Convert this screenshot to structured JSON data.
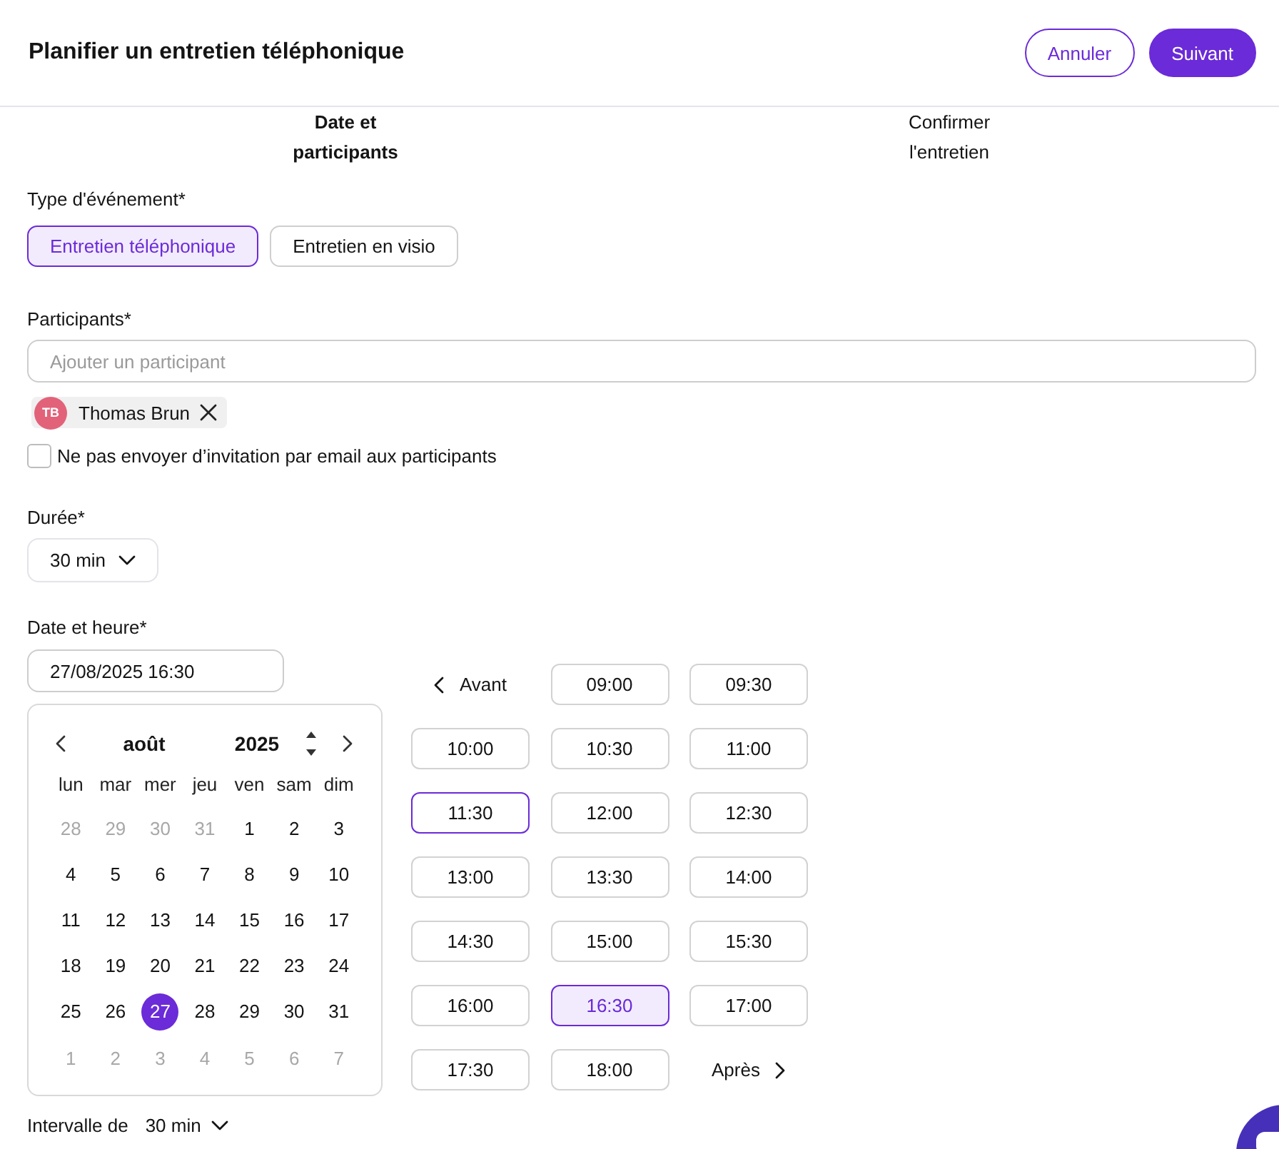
{
  "header": {
    "title": "Planifier un entretien téléphonique",
    "buttons": [
      {
        "label": "Annuler",
        "kind": "outline"
      },
      {
        "label": "Suivant",
        "kind": "filled"
      }
    ]
  },
  "steps": [
    {
      "label": "Date et participants",
      "selected": true
    },
    {
      "label": "Confirmer l'entretien",
      "selected": false
    }
  ],
  "event_type": {
    "label": "Type d'événement*",
    "options": [
      {
        "label": "Entretien téléphonique",
        "selected": true
      },
      {
        "label": "Entretien en visio",
        "selected": false
      }
    ]
  },
  "participants": {
    "label": "Participants*",
    "placeholder": "Ajouter un participant",
    "chips": [
      {
        "initials": "TB",
        "name": "Thomas Brun",
        "color": "#e2627a"
      }
    ],
    "no_invite_checkbox": {
      "label": "Ne pas envoyer d’invitation par email aux participants",
      "checked": false
    }
  },
  "duration": {
    "label": "Durée*",
    "value": "30 min"
  },
  "date_time": {
    "label": "Date et heure*",
    "value": "27/08/2025 16:30",
    "calendar": {
      "month": "août",
      "year": "2025",
      "weekdays": [
        "lun",
        "mar",
        "mer",
        "jeu",
        "ven",
        "sam",
        "dim"
      ],
      "weeks": [
        [
          {
            "day": "28",
            "outside": true,
            "selected": false
          },
          {
            "day": "29",
            "outside": true,
            "selected": false
          },
          {
            "day": "30",
            "outside": true,
            "selected": false
          },
          {
            "day": "31",
            "outside": true,
            "selected": false
          },
          {
            "day": "1",
            "outside": false,
            "selected": false
          },
          {
            "day": "2",
            "outside": false,
            "selected": false
          },
          {
            "day": "3",
            "outside": false,
            "selected": false
          }
        ],
        [
          {
            "day": "4",
            "outside": false,
            "selected": false
          },
          {
            "day": "5",
            "outside": false,
            "selected": false
          },
          {
            "day": "6",
            "outside": false,
            "selected": false
          },
          {
            "day": "7",
            "outside": false,
            "selected": false
          },
          {
            "day": "8",
            "outside": false,
            "selected": false
          },
          {
            "day": "9",
            "outside": false,
            "selected": false
          },
          {
            "day": "10",
            "outside": false,
            "selected": false
          }
        ],
        [
          {
            "day": "11",
            "outside": false,
            "selected": false
          },
          {
            "day": "12",
            "outside": false,
            "selected": false
          },
          {
            "day": "13",
            "outside": false,
            "selected": false
          },
          {
            "day": "14",
            "outside": false,
            "selected": false
          },
          {
            "day": "15",
            "outside": false,
            "selected": false
          },
          {
            "day": "16",
            "outside": false,
            "selected": false
          },
          {
            "day": "17",
            "outside": false,
            "selected": false
          }
        ],
        [
          {
            "day": "18",
            "outside": false,
            "selected": false
          },
          {
            "day": "19",
            "outside": false,
            "selected": false
          },
          {
            "day": "20",
            "outside": false,
            "selected": false
          },
          {
            "day": "21",
            "outside": false,
            "selected": false
          },
          {
            "day": "22",
            "outside": false,
            "selected": false
          },
          {
            "day": "23",
            "outside": false,
            "selected": false
          },
          {
            "day": "24",
            "outside": false,
            "selected": false
          }
        ],
        [
          {
            "day": "25",
            "outside": false,
            "selected": false
          },
          {
            "day": "26",
            "outside": false,
            "selected": false
          },
          {
            "day": "27",
            "outside": false,
            "selected": true
          },
          {
            "day": "28",
            "outside": false,
            "selected": false
          },
          {
            "day": "29",
            "outside": false,
            "selected": false
          },
          {
            "day": "30",
            "outside": false,
            "selected": false
          },
          {
            "day": "31",
            "outside": false,
            "selected": false
          }
        ],
        [
          {
            "day": "1",
            "outside": true,
            "selected": false
          },
          {
            "day": "2",
            "outside": true,
            "selected": false
          },
          {
            "day": "3",
            "outside": true,
            "selected": false
          },
          {
            "day": "4",
            "outside": true,
            "selected": false
          },
          {
            "day": "5",
            "outside": true,
            "selected": false
          },
          {
            "day": "6",
            "outside": true,
            "selected": false
          },
          {
            "day": "7",
            "outside": true,
            "selected": false
          }
        ]
      ]
    },
    "slots": {
      "previous": "Avant",
      "next": "Après",
      "times": [
        {
          "time": "09:00",
          "selected": false,
          "highlighted": false
        },
        {
          "time": "09:30",
          "selected": false,
          "highlighted": false
        },
        {
          "time": "10:00",
          "selected": false,
          "highlighted": false
        },
        {
          "time": "10:30",
          "selected": false,
          "highlighted": false
        },
        {
          "time": "11:00",
          "selected": false,
          "highlighted": false
        },
        {
          "time": "11:30",
          "selected": false,
          "highlighted": true
        },
        {
          "time": "12:00",
          "selected": false,
          "highlighted": false
        },
        {
          "time": "12:30",
          "selected": false,
          "highlighted": false
        },
        {
          "time": "13:00",
          "selected": false,
          "highlighted": false
        },
        {
          "time": "13:30",
          "selected": false,
          "highlighted": false
        },
        {
          "time": "14:00",
          "selected": false,
          "highlighted": false
        },
        {
          "time": "14:30",
          "selected": false,
          "highlighted": false
        },
        {
          "time": "15:00",
          "selected": false,
          "highlighted": false
        },
        {
          "time": "15:30",
          "selected": false,
          "highlighted": false
        },
        {
          "time": "16:00",
          "selected": false,
          "highlighted": false
        },
        {
          "time": "16:30",
          "selected": true,
          "highlighted": false
        },
        {
          "time": "17:00",
          "selected": false,
          "highlighted": false
        },
        {
          "time": "17:30",
          "selected": false,
          "highlighted": false
        },
        {
          "time": "18:00",
          "selected": false,
          "highlighted": false
        }
      ]
    }
  },
  "interval": {
    "label": "Intervalle de",
    "value": "30 min"
  }
}
